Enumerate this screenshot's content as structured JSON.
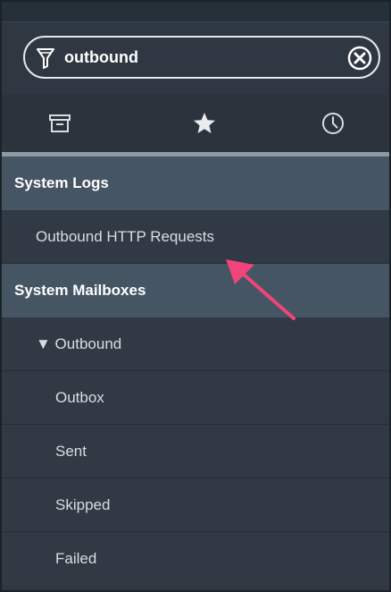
{
  "filter": {
    "value": "outbound"
  },
  "nav_tabs": [
    {
      "icon": "archive-icon"
    },
    {
      "icon": "star-icon"
    },
    {
      "icon": "clock-icon"
    }
  ],
  "menu": [
    {
      "label": "System Logs",
      "kind": "header"
    },
    {
      "label": "Outbound HTTP Requests",
      "kind": "item"
    },
    {
      "label": "System Mailboxes",
      "kind": "header"
    },
    {
      "label": "▼ Outbound",
      "kind": "item"
    },
    {
      "label": "Outbox",
      "kind": "item"
    },
    {
      "label": "Sent",
      "kind": "item"
    },
    {
      "label": "Skipped",
      "kind": "item"
    },
    {
      "label": "Failed",
      "kind": "item"
    }
  ],
  "annotation": {
    "color": "#f0447a",
    "icon": "pointer-arrow-icon"
  },
  "colors": {
    "panel": "#2f3742",
    "header": "#465564",
    "accent_bar": "#8e99a3"
  }
}
